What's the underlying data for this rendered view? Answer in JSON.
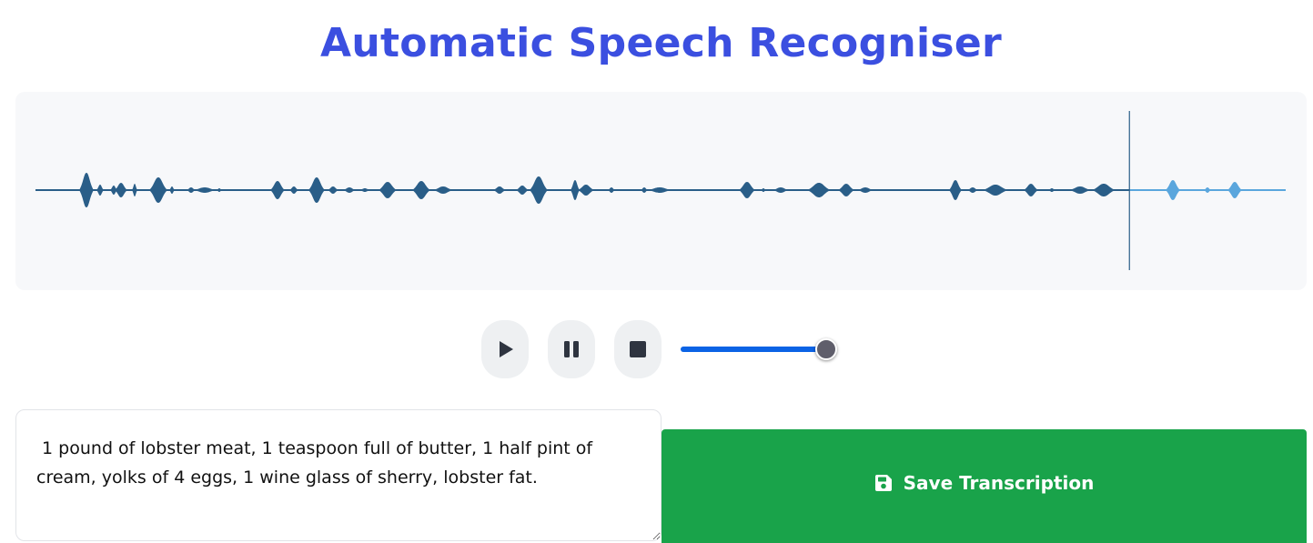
{
  "app": {
    "title": "Automatic Speech Recogniser"
  },
  "waveform": {
    "played_color": "#2a5e88",
    "unplayed_color": "#5aa6dd",
    "cursor_color": "#2a5e88",
    "playback_progress": 0.875
  },
  "controls": {
    "play_icon": "play-icon",
    "pause_icon": "pause-icon",
    "stop_icon": "stop-icon",
    "volume_level": 1.0
  },
  "transcription": {
    "text": " 1 pound of lobster meat, 1 teaspoon full of butter, 1 half pint of cream, yolks of 4 eggs, 1 wine glass of sherry, lobster fat."
  },
  "save": {
    "label": "Save Transcription",
    "icon": "floppy-disk-icon",
    "color": "#19a34a"
  }
}
